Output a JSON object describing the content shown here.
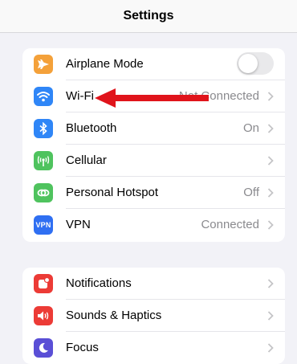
{
  "nav": {
    "title": "Settings"
  },
  "group1": [
    {
      "label": "Airplane Mode",
      "icon": "airplane-icon",
      "color": "#f4a13a",
      "control": "toggle",
      "toggle_on": false
    },
    {
      "label": "Wi-Fi",
      "icon": "wifi-icon",
      "color": "#2f86f7",
      "value": "Not Connected"
    },
    {
      "label": "Bluetooth",
      "icon": "bluetooth-icon",
      "color": "#2f86f7",
      "value": "On"
    },
    {
      "label": "Cellular",
      "icon": "cellular-icon",
      "color": "#4fc35e",
      "value": ""
    },
    {
      "label": "Personal Hotspot",
      "icon": "hotspot-icon",
      "color": "#4fc35e",
      "value": "Off"
    },
    {
      "label": "VPN",
      "icon": "vpn-icon",
      "icon_text": "VPN",
      "color": "#2f6ff2",
      "value": "Connected"
    }
  ],
  "group2": [
    {
      "label": "Notifications",
      "icon": "notifications-icon",
      "color": "#ec3b36"
    },
    {
      "label": "Sounds & Haptics",
      "icon": "sounds-icon",
      "color": "#ec3b36"
    },
    {
      "label": "Focus",
      "icon": "focus-icon",
      "color": "#5a4fd6"
    }
  ],
  "annotation": {
    "icon": "red-arrow-icon",
    "color": "#e0141b",
    "points_to": "Wi-Fi"
  }
}
